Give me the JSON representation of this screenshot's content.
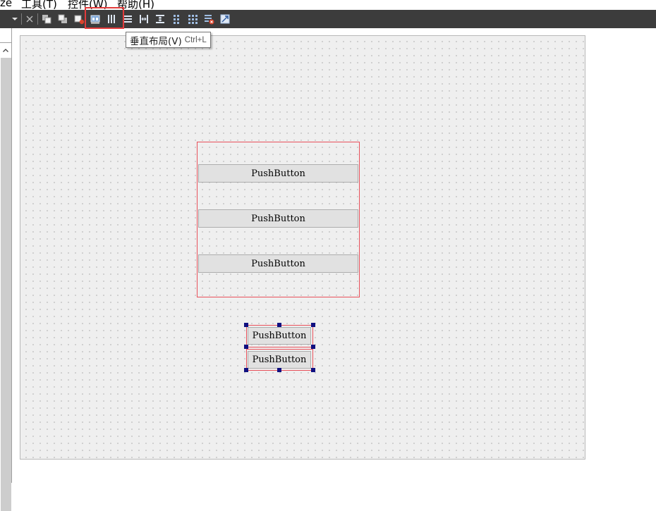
{
  "menubar": {
    "items": [
      {
        "label": "ze"
      },
      {
        "label": "工具(T)"
      },
      {
        "label": "控件(W)"
      },
      {
        "label": "帮助(H)"
      }
    ]
  },
  "toolbar": {
    "icons": [
      "dropdown-arrow-icon",
      "close-icon",
      "bring-to-front-icon",
      "send-to-back-icon",
      "tab-order-icon",
      "horizontal-layout-icon",
      "vertical-layout-icon",
      "form-layout-icon",
      "horizontal-splitter-icon",
      "vertical-splitter-icon",
      "grid-layout-icon",
      "grid-icon",
      "break-layout-icon",
      "adjust-size-icon"
    ]
  },
  "tooltip": {
    "title": "垂直布局(V)",
    "shortcut": "Ctrl+L"
  },
  "form": {
    "vertical_layout_buttons": [
      {
        "label": "PushButton"
      },
      {
        "label": "PushButton"
      },
      {
        "label": "PushButton"
      }
    ],
    "selected_buttons": [
      {
        "label": "PushButton"
      },
      {
        "label": "PushButton"
      }
    ]
  },
  "colors": {
    "toolbar": "#3c3c3c",
    "highlight": "#e23b3b",
    "layout_border": "#e8505a",
    "handle": "#101080"
  }
}
